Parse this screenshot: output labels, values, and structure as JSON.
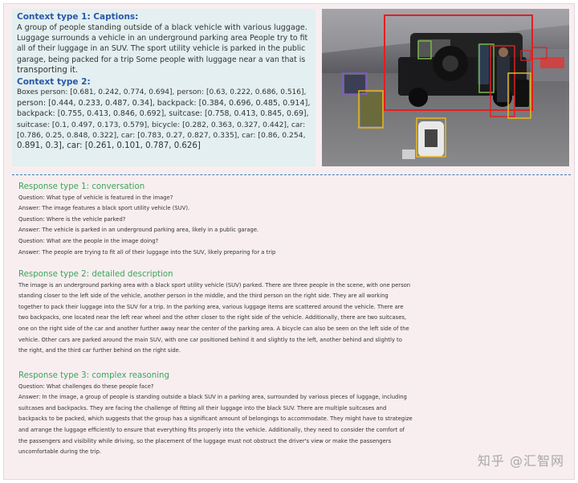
{
  "context": {
    "captions_heading": "Context type 1: Captions:",
    "captions_lines": [
      "A group of people standing outside of a black vehicle with various luggage.",
      "Luggage surrounds a vehicle in an underground parking area People try to fit",
      "all of their luggage in an SUV. The sport utility vehicle is parked in the public",
      "garage, being packed for a trip Some people with luggage near a van that is",
      "transporting it."
    ],
    "boxes_heading": "Context type 2:",
    "boxes_lines": [
      "Boxes person: [0.681, 0.242, 0.774, 0.694], person: [0.63, 0.222, 0.686, 0.516],",
      "person: [0.444, 0.233, 0.487, 0.34], backpack: [0.384, 0.696, 0.485, 0.914],",
      "backpack: [0.755, 0.413, 0.846, 0.692], suitcase: [0.758, 0.413, 0.845, 0.69],",
      "suitcase: [0.1, 0.497, 0.173, 0.579], bicycle: [0.282, 0.363, 0.327, 0.442], car:",
      "[0.786, 0.25, 0.848, 0.322], car: [0.783, 0.27, 0.827, 0.335], car: [0.86, 0.254,",
      "0.891, 0.3], car: [0.261, 0.101, 0.787, 0.626]"
    ]
  },
  "responses": {
    "conversation_heading": "Response type 1: conversation",
    "conversation_lines": [
      "Question: What type of vehicle is featured in the image?",
      "Answer: The image features a black sport utility vehicle (SUV).",
      "Question: Where is the vehicle parked?",
      "Answer: The vehicle is parked in an underground parking area, likely in a public garage.",
      "Question: What are the people in the image doing?",
      "Answer: The people are trying to fit all of their luggage into the SUV, likely preparing for a trip"
    ],
    "detailed_heading": "Response type 2: detailed description",
    "detailed_lines": [
      "The image is an underground parking area with a black sport utility vehicle (SUV) parked. There are three people in the scene, with one person",
      "standing closer to the left side of the vehicle, another person in the middle, and the third person on the right side. They are all working",
      "together to pack their luggage into the SUV for a trip. In the parking area, various luggage items are scattered around the vehicle. There are",
      "two backpacks, one located near the left rear wheel and the other closer to the right side of the vehicle. Additionally, there are two suitcases,",
      "one on the right side of the car and another further away near the center of the parking area. A bicycle can also be seen on the left side of the",
      "vehicle. Other cars are parked around the main SUV, with one car positioned behind it and slightly to the left, another behind and slightly to",
      "the right, and the third car further behind on the right side."
    ],
    "reasoning_heading": "Response type 3: complex reasoning",
    "reasoning_lines": [
      "Question: What challenges do these people face?",
      "Answer: In the image, a group of people is standing outside a black SUV in a parking area, surrounded by various pieces of luggage, including",
      "suitcases and backpacks. They are facing the challenge of fitting all their luggage into the black SUV. There are multiple suitcases and",
      "backpacks to be packed, which suggests that the group has a significant amount of belongings to accommodate. They might have to strategize",
      "and arrange the luggage efficiently to ensure that everything fits properly into the vehicle. Additionally, they need to consider the comfort of",
      "the passengers and visibility while driving, so the placement of the luggage must not obstruct the driver's view or make the passengers",
      "uncomfortable during the trip."
    ]
  },
  "watermark": "知乎 @汇智网",
  "colors": {
    "context_heading": "#2b57a8",
    "response_heading": "#3aa55a",
    "divider": "#3f7fb7",
    "box_red": "#e02020",
    "box_green": "#7ab84a",
    "box_yellow": "#e8b820",
    "box_purple": "#7e5bc8"
  }
}
